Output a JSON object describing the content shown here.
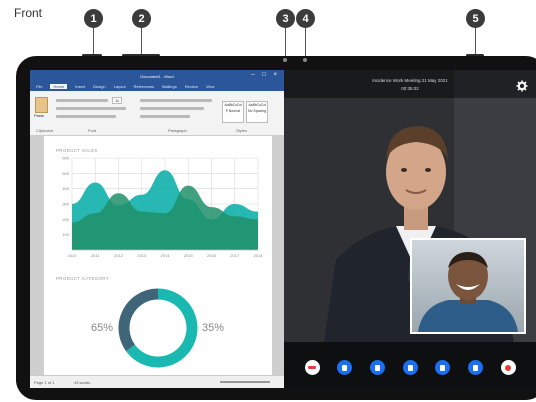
{
  "figure": {
    "label": "Front",
    "callouts": [
      "1",
      "2",
      "3",
      "4",
      "5"
    ]
  },
  "word_app": {
    "title": "Document1 - Word",
    "tabs": [
      "File",
      "Home",
      "Insert",
      "Design",
      "Layout",
      "References",
      "Mailings",
      "Review",
      "View"
    ],
    "active_tab": "Home",
    "ribbon_groups": [
      "Clipboard",
      "Font",
      "Paragraph",
      "Styles"
    ],
    "paste_label": "Paste",
    "font_size": "11",
    "styles": [
      {
        "sample": "AaBbCcDd",
        "name": "¶ Normal"
      },
      {
        "sample": "AaBbCcDd",
        "name": "No Spacing"
      }
    ],
    "doc": {
      "sales_title": "PRODUCT SALES",
      "category_title": "PRODUCT CATEGORY",
      "donut_left_label": "65%",
      "donut_right_label": "35%"
    },
    "status": {
      "page": "Page 1 of 1",
      "words": "43 words"
    }
  },
  "video_app": {
    "meeting_title": "Incidence Work Meeting 21 May 2021",
    "elapsed": "00:35:02",
    "settings_icon": "gear-icon",
    "controls": [
      {
        "icon": "end-call-icon",
        "style": "white",
        "color": "#e43b3b"
      },
      {
        "icon": "microphone-icon",
        "style": "blue",
        "color": "#ffffff"
      },
      {
        "icon": "camera-icon",
        "style": "blue",
        "color": "#ffffff"
      },
      {
        "icon": "chat-icon",
        "style": "blue",
        "color": "#ffffff"
      },
      {
        "icon": "participants-icon",
        "style": "blue",
        "color": "#ffffff"
      },
      {
        "icon": "share-screen-icon",
        "style": "blue",
        "color": "#ffffff"
      },
      {
        "icon": "record-icon",
        "style": "white",
        "color": "#e43b3b"
      }
    ]
  },
  "chart_data": [
    {
      "type": "area",
      "title": "PRODUCT SALES",
      "ylim": [
        0,
        600
      ],
      "y_ticks": [
        100,
        200,
        300,
        400,
        500,
        600
      ],
      "x_ticks": [
        2010,
        2011,
        2012,
        2013,
        2014,
        2015,
        2016,
        2017,
        2018
      ],
      "series": [
        {
          "values": [
            300,
            440,
            290,
            360,
            520,
            330,
            200,
            300,
            250
          ],
          "color": "#16b2ac"
        },
        {
          "values": [
            180,
            240,
            370,
            250,
            240,
            420,
            280,
            220,
            200
          ],
          "color": "#1e8f6a"
        }
      ],
      "grid": true
    },
    {
      "type": "pie",
      "title": "PRODUCT CATEGORY",
      "donut": true,
      "slices": [
        {
          "label": "65%",
          "value": 65,
          "color": "#19b9b1"
        },
        {
          "label": "35%",
          "value": 35,
          "color": "#3f6579"
        }
      ]
    }
  ],
  "colors": {
    "word_blue": "#2b579a",
    "accent_teal": "#16b2ac",
    "accent_green": "#1e8f6a",
    "call_blue": "#1c6ef2",
    "call_red": "#e43b3b"
  }
}
